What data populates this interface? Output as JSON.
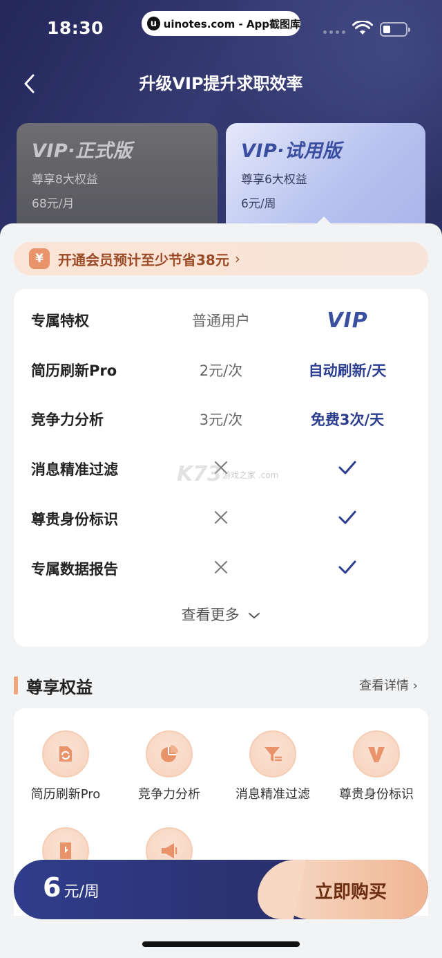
{
  "status_bar": {
    "time": "18:30",
    "watermark": "uinotes.com - App截图库",
    "watermark_logo": "u"
  },
  "header": {
    "title": "升级VIP提升求职效率",
    "back_icon": "chevron-left-icon"
  },
  "plans": [
    {
      "name": "VIP·正式版",
      "benefits": "尊享8大权益",
      "price": "68元/月",
      "selected": false
    },
    {
      "name": "VIP·试用版",
      "benefits": "尊享6大权益",
      "price": "6元/周",
      "selected": true
    }
  ],
  "saving_banner": {
    "text": "开通会员预计至少节省38元",
    "icon_glyph": "¥",
    "chevron": "›"
  },
  "comparison": {
    "header": {
      "feature": "专属特权",
      "normal": "普通用户",
      "vip": "VIP"
    },
    "rows": [
      {
        "feature": "简历刷新Pro",
        "normal": "2元/次",
        "vip": "自动刷新/天"
      },
      {
        "feature": "竞争力分析",
        "normal": "3元/次",
        "vip": "免费3次/天"
      },
      {
        "feature": "消息精准过滤",
        "normal": "cross-icon",
        "vip": "check-icon"
      },
      {
        "feature": "尊贵身份标识",
        "normal": "cross-icon",
        "vip": "check-icon"
      },
      {
        "feature": "专属数据报告",
        "normal": "cross-icon",
        "vip": "check-icon"
      }
    ],
    "more_label": "查看更多"
  },
  "watermark_k73": {
    "logo": "K73",
    "sub": "游戏之家 .com"
  },
  "benefits_section": {
    "title": "尊享权益",
    "detail_link": "查看详情 ›",
    "items": [
      {
        "label": "简历刷新Pro",
        "icon": "refresh-icon"
      },
      {
        "label": "竞争力分析",
        "icon": "pie-chart-icon"
      },
      {
        "label": "消息精准过滤",
        "icon": "filter-icon"
      },
      {
        "label": "尊贵身份标识",
        "icon": "v-badge-icon"
      },
      {
        "label": "",
        "icon": "report-icon"
      },
      {
        "label": "",
        "icon": "megaphone-icon"
      }
    ]
  },
  "buy_bar": {
    "price_number": "6",
    "price_unit": "元/周",
    "button_label": "立即购买"
  },
  "colors": {
    "header_bg": "#2a2f62",
    "vip_blue": "#2b3d8f",
    "accent_orange": "#efb592",
    "saving_text": "#9a4a26"
  }
}
